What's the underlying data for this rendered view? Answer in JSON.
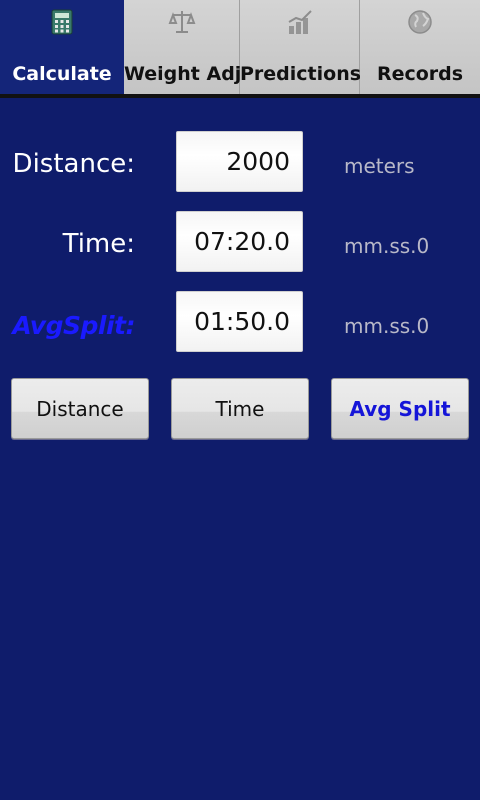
{
  "tabs": [
    {
      "label": "Calculate",
      "icon": "calculator-icon",
      "active": true
    },
    {
      "label": "Weight Adj",
      "icon": "scale-icon",
      "active": false
    },
    {
      "label": "Predictions",
      "icon": "chart-icon",
      "active": false
    },
    {
      "label": "Records",
      "icon": "globe-icon",
      "active": false
    }
  ],
  "form": {
    "distance": {
      "label": "Distance:",
      "value": "2000",
      "unit": "meters"
    },
    "time": {
      "label": "Time:",
      "value": "07:20.0",
      "unit": "mm.ss.0"
    },
    "avgsplit": {
      "label": "AvgSplit:",
      "value": "01:50.0",
      "unit": "mm.ss.0"
    }
  },
  "buttons": {
    "distance": "Distance",
    "time": "Time",
    "avgsplit": "Avg Split"
  },
  "colors": {
    "background": "#0f1c6b",
    "active_tab": "#142579",
    "highlight": "#1a1aff"
  }
}
